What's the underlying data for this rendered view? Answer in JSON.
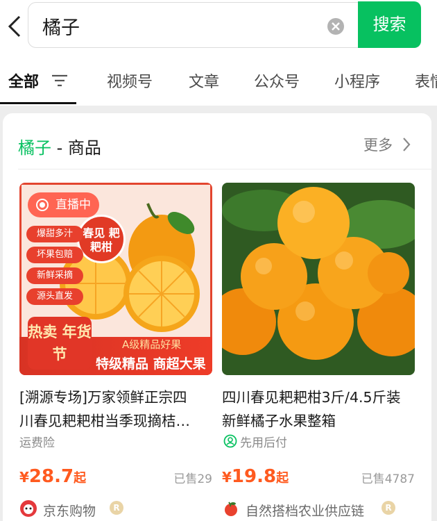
{
  "search": {
    "query": "橘子",
    "button_label": "搜索"
  },
  "tabs": [
    {
      "label": "全部",
      "active": true
    },
    {
      "label": "视频号"
    },
    {
      "label": "文章"
    },
    {
      "label": "公众号"
    },
    {
      "label": "小程序"
    },
    {
      "label": "表情"
    }
  ],
  "section": {
    "keyword": "橘子",
    "title_suffix": " - 商品",
    "more_label": "更多"
  },
  "products": [
    {
      "title_line1": "[溯源专场]万家领鲜正宗四",
      "title_line2": "川春见耙耙柑当季现摘桔…",
      "tag": "运费险",
      "price_currency": "¥",
      "price": "28.7",
      "price_suffix": "起",
      "sold": "已售29",
      "shop": "京东购物",
      "shop_badge": "R",
      "image": {
        "live_label": "直播中",
        "badge_text": "春见 耙耙柑",
        "side_tags": [
          "爆甜多汁",
          "坏果包赔",
          "新鲜采摘",
          "源头直发"
        ],
        "promo": "热卖 年货节",
        "grade": "A级精品好果",
        "banner": "特级精品 商超大果"
      }
    },
    {
      "title_line1": "四川春见耙耙柑3斤/4.5斤装",
      "title_line2": "新鲜橘子水果整箱",
      "tag": "先用后付",
      "price_currency": "¥",
      "price": "19.8",
      "price_suffix": "起",
      "sold": "已售4787",
      "shop": "自然搭档农业供应链",
      "shop_badge": "R"
    }
  ],
  "colors": {
    "accent": "#07c160",
    "price": "#ff5a1f",
    "live": "#ff5a46"
  }
}
